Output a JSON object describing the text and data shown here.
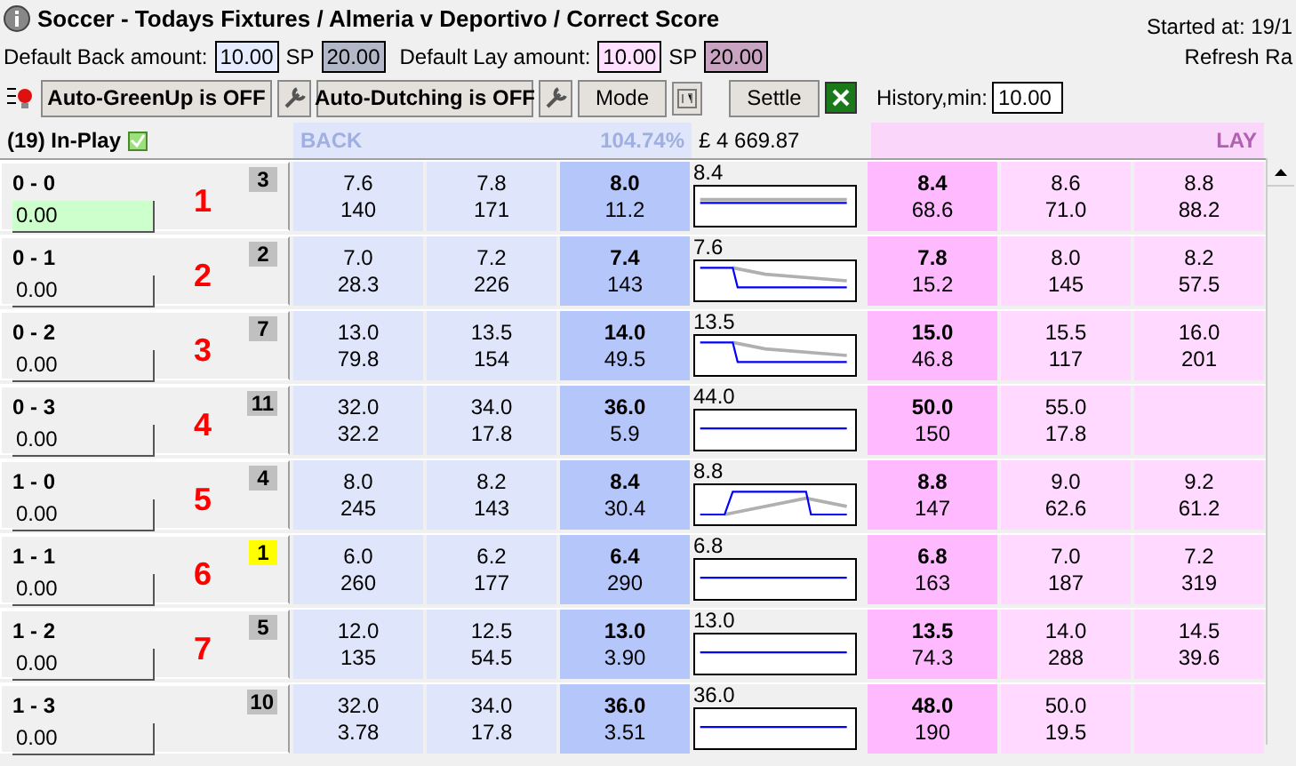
{
  "window": {
    "title": "Soccer - Todays Fixtures / Almeria v Deportivo / Correct Score",
    "started": "Started at: 19/1",
    "refresh": "Refresh Ra"
  },
  "defaults": {
    "back_label": "Default Back amount:",
    "back_value": "10.00",
    "back_sp_label": "SP",
    "back_sp_value": "20.00",
    "lay_label": "Default Lay amount:",
    "lay_value": "10.00",
    "lay_sp_label": "SP",
    "lay_sp_value": "20.00"
  },
  "toolbar": {
    "greenup": "Auto-GreenUp is OFF",
    "dutching": "Auto-Dutching is OFF",
    "mode": "Mode",
    "settle": "Settle",
    "history_label": "History,min:",
    "history_value": "10.00"
  },
  "header": {
    "inplay": "(19) In-Play",
    "inplay_checked": true,
    "back": "BACK",
    "percent": "104.74%",
    "amount": "£ 4 669.87",
    "lay": "LAY"
  },
  "runners": [
    {
      "name": "0 - 0",
      "stake": "0.00",
      "active": true,
      "badge": "3",
      "color": "#c0c0c0",
      "rank": "1",
      "back": [
        [
          "7.6",
          "140"
        ],
        [
          "7.8",
          "171"
        ],
        [
          "8.0",
          "11.2"
        ]
      ],
      "last": "8.4",
      "lay": [
        [
          "8.4",
          "68.6"
        ],
        [
          "8.6",
          "71.0"
        ],
        [
          "8.8",
          "88.2"
        ]
      ]
    },
    {
      "name": "0 - 1",
      "stake": "0.00",
      "active": false,
      "badge": "2",
      "color": "#c0c0c0",
      "rank": "2",
      "back": [
        [
          "7.0",
          "28.3"
        ],
        [
          "7.2",
          "226"
        ],
        [
          "7.4",
          "143"
        ]
      ],
      "last": "7.6",
      "lay": [
        [
          "7.8",
          "15.2"
        ],
        [
          "8.0",
          "145"
        ],
        [
          "8.2",
          "57.5"
        ]
      ]
    },
    {
      "name": "0 - 2",
      "stake": "0.00",
      "active": false,
      "badge": "7",
      "color": "#c0c0c0",
      "rank": "3",
      "back": [
        [
          "13.0",
          "79.8"
        ],
        [
          "13.5",
          "154"
        ],
        [
          "14.0",
          "49.5"
        ]
      ],
      "last": "13.5",
      "lay": [
        [
          "15.0",
          "46.8"
        ],
        [
          "15.5",
          "117"
        ],
        [
          "16.0",
          "201"
        ]
      ]
    },
    {
      "name": "0 - 3",
      "stake": "0.00",
      "active": false,
      "badge": "11",
      "color": "#c0c0c0",
      "rank": "4",
      "back": [
        [
          "32.0",
          "32.2"
        ],
        [
          "34.0",
          "17.8"
        ],
        [
          "36.0",
          "5.9"
        ]
      ],
      "last": "44.0",
      "lay": [
        [
          "50.0",
          "150"
        ],
        [
          "55.0",
          "17.8"
        ]
      ]
    },
    {
      "name": "1 - 0",
      "stake": "0.00",
      "active": false,
      "badge": "4",
      "color": "#c0c0c0",
      "rank": "5",
      "back": [
        [
          "8.0",
          "245"
        ],
        [
          "8.2",
          "143"
        ],
        [
          "8.4",
          "30.4"
        ]
      ],
      "last": "8.8",
      "lay": [
        [
          "8.8",
          "147"
        ],
        [
          "9.0",
          "62.6"
        ],
        [
          "9.2",
          "61.2"
        ]
      ]
    },
    {
      "name": "1 - 1",
      "stake": "0.00",
      "active": false,
      "badge": "1",
      "color": "#ffff00",
      "rank": "6",
      "back": [
        [
          "6.0",
          "260"
        ],
        [
          "6.2",
          "177"
        ],
        [
          "6.4",
          "290"
        ]
      ],
      "last": "6.8",
      "lay": [
        [
          "6.8",
          "163"
        ],
        [
          "7.0",
          "187"
        ],
        [
          "7.2",
          "319"
        ]
      ]
    },
    {
      "name": "1 - 2",
      "stake": "0.00",
      "active": false,
      "badge": "5",
      "color": "#c0c0c0",
      "rank": "7",
      "back": [
        [
          "12.0",
          "135"
        ],
        [
          "12.5",
          "54.5"
        ],
        [
          "13.0",
          "3.90"
        ]
      ],
      "last": "13.0",
      "lay": [
        [
          "13.5",
          "74.3"
        ],
        [
          "14.0",
          "288"
        ],
        [
          "14.5",
          "39.6"
        ]
      ]
    },
    {
      "name": "1 - 3",
      "stake": "0.00",
      "active": false,
      "badge": "10",
      "color": "#c0c0c0",
      "back": [
        [
          "32.0",
          "3.78"
        ],
        [
          "34.0",
          "17.8"
        ],
        [
          "36.0",
          "3.51"
        ]
      ],
      "last": "36.0",
      "lay": [
        [
          "48.0",
          "190"
        ],
        [
          "50.0",
          "19.5"
        ]
      ]
    }
  ]
}
